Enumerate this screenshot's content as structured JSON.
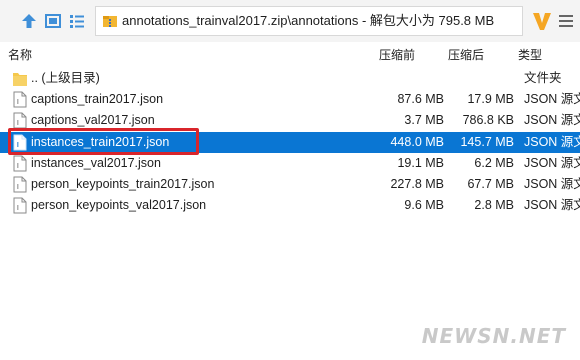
{
  "toolbar": {
    "up_icon": "up-arrow-icon",
    "thumb_icon": "thumbnail-view-icon",
    "list_icon": "list-view-icon",
    "address_path": "annotations_trainval2017.zip\\annotations - 解包大小为 795.8 MB",
    "logo_icon": "brand-v-logo-icon",
    "menu_icon": "hamburger-menu-icon"
  },
  "columns": {
    "name": "名称",
    "compressed": "压缩前",
    "packed": "压缩后",
    "type": "类型"
  },
  "files": [
    {
      "name": ".. (上级目录)",
      "compressed": "",
      "packed": "",
      "type": "文件夹",
      "icon": "folder-icon",
      "selected": false
    },
    {
      "name": "captions_train2017.json",
      "compressed": "87.6 MB",
      "packed": "17.9 MB",
      "type": "JSON 源文",
      "icon": "json-file-icon",
      "selected": false
    },
    {
      "name": "captions_val2017.json",
      "compressed": "3.7 MB",
      "packed": "786.8 KB",
      "type": "JSON 源文",
      "icon": "json-file-icon",
      "selected": false
    },
    {
      "name": "instances_train2017.json",
      "compressed": "448.0 MB",
      "packed": "145.7 MB",
      "type": "JSON 源文",
      "icon": "json-file-icon",
      "selected": true
    },
    {
      "name": "instances_val2017.json",
      "compressed": "19.1 MB",
      "packed": "6.2 MB",
      "type": "JSON 源文",
      "icon": "json-file-icon",
      "selected": false
    },
    {
      "name": "person_keypoints_train2017.json",
      "compressed": "227.8 MB",
      "packed": "67.7 MB",
      "type": "JSON 源文",
      "icon": "json-file-icon",
      "selected": false
    },
    {
      "name": "person_keypoints_val2017.json",
      "compressed": "9.6 MB",
      "packed": "2.8 MB",
      "type": "JSON 源文",
      "icon": "json-file-icon",
      "selected": false
    }
  ],
  "watermark": "NEWSN.NET",
  "colors": {
    "selection": "#0a76d3",
    "highlight_border": "#d9252b",
    "logo": "#f5a623"
  }
}
